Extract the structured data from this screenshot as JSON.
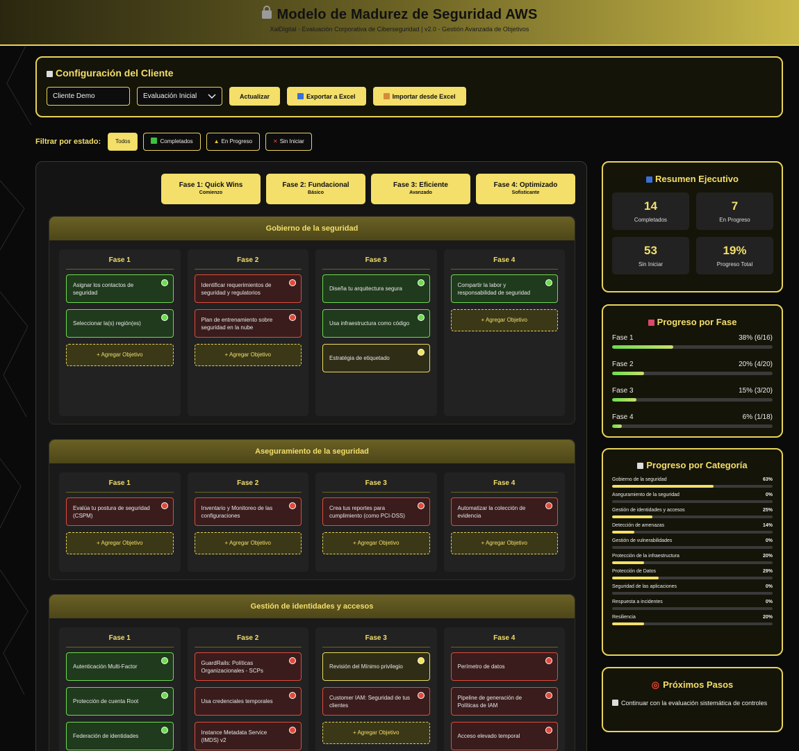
{
  "header": {
    "title": "Modelo de Madurez de Seguridad AWS",
    "subtitle": "XalDigital - Evaluación Corporativa de Ciberseguridad | v2.0 - Gestión Avanzada de Objetivos"
  },
  "config": {
    "title": "Configuración del Cliente",
    "client_value": "Cliente Demo",
    "eval_select": "Evaluación Inicial",
    "update_label": "Actualizar",
    "export_label": "Exportar a Excel",
    "import_label": "Importar desde Excel"
  },
  "filter": {
    "label": "Filtrar por estado:",
    "all": "Todos",
    "completed": "Completados",
    "in_progress": "En Progreso",
    "not_started": "Sin Iniciar"
  },
  "phases": [
    {
      "title": "Fase 1: Quick Wins",
      "sub": "Comienzo"
    },
    {
      "title": "Fase 2: Fundacional",
      "sub": "Básico"
    },
    {
      "title": "Fase 3: Eficiente",
      "sub": "Avanzado"
    },
    {
      "title": "Fase 4: Optimizado",
      "sub": "Sofisticante"
    }
  ],
  "col_labels": [
    "Fase 1",
    "Fase 2",
    "Fase 3",
    "Fase 4"
  ],
  "add_label": "+ Agregar Objetivo",
  "domains": [
    {
      "name": "Gobierno de la seguridad",
      "cols": [
        [
          {
            "text": "Asignar los contactos de seguridad",
            "status": "g"
          },
          {
            "text": "Seleccionar la(s) región(es)",
            "status": "g"
          }
        ],
        [
          {
            "text": "Identificar requerimientos de seguridad y regulatorios",
            "status": "r"
          },
          {
            "text": "Plan de entrenamiento sobre seguridad en la nube",
            "status": "r"
          }
        ],
        [
          {
            "text": "Diseña tu arquitectura segura",
            "status": "g"
          },
          {
            "text": "Usa infraestructura como código",
            "status": "g"
          },
          {
            "text": "Estratégia de etiquetado",
            "status": "y"
          }
        ],
        [
          {
            "text": "Compartir la labor y responsabilidad de seguridad",
            "status": "g"
          }
        ]
      ]
    },
    {
      "name": "Aseguramiento de la seguridad",
      "cols": [
        [
          {
            "text": "Evalúa tu postura de seguridad (CSPM)",
            "status": "r"
          }
        ],
        [
          {
            "text": "Inventario y Monitoreo de las configuraciones",
            "status": "r"
          }
        ],
        [
          {
            "text": "Crea tus reportes para cumplimiento (como PCI-DSS)",
            "status": "r"
          }
        ],
        [
          {
            "text": "Automatizar la colección de evidencia",
            "status": "r"
          }
        ]
      ]
    },
    {
      "name": "Gestión de identidades y accesos",
      "cols": [
        [
          {
            "text": "Autenticación Multi-Factor",
            "status": "g"
          },
          {
            "text": "Protección de cuenta Root",
            "status": "g"
          },
          {
            "text": "Federación de identidades",
            "status": "g"
          }
        ],
        [
          {
            "text": "GuardRails: Políticas Organizacionales - SCPs",
            "status": "r"
          },
          {
            "text": "Usa credenciales temporales",
            "status": "r"
          },
          {
            "text": "Instance Metadata Service (IMDS) v2",
            "status": "r"
          }
        ],
        [
          {
            "text": "Revisión del Mínimo privilegio",
            "status": "y"
          },
          {
            "text": "Customer IAM: Seguridad de tus clientes",
            "status": "r"
          }
        ],
        [
          {
            "text": "Perímetro de datos",
            "status": "r"
          },
          {
            "text": "Pipeline de generación de Políticas de IAM",
            "status": "r"
          },
          {
            "text": "Acceso elevado temporal",
            "status": "r"
          }
        ]
      ]
    }
  ],
  "summary": {
    "title": "Resumen Ejecutivo",
    "stats": [
      {
        "value": "14",
        "label": "Completados"
      },
      {
        "value": "7",
        "label": "En Progreso"
      },
      {
        "value": "53",
        "label": "Sin Iniciar"
      },
      {
        "value": "19%",
        "label": "Progreso Total"
      }
    ]
  },
  "phase_progress": {
    "title": "Progreso por Fase",
    "rows": [
      {
        "label": "Fase 1",
        "value": "38% (6/16)",
        "pct": 38
      },
      {
        "label": "Fase 2",
        "value": "20% (4/20)",
        "pct": 20
      },
      {
        "label": "Fase 3",
        "value": "15% (3/20)",
        "pct": 15
      },
      {
        "label": "Fase 4",
        "value": "6% (1/18)",
        "pct": 6
      }
    ]
  },
  "category_progress": {
    "title": "Progreso por Categoría",
    "rows": [
      {
        "label": "Gobierno de la seguridad",
        "value": "63%",
        "pct": 63
      },
      {
        "label": "Aseguramiento de la seguridad",
        "value": "0%",
        "pct": 0
      },
      {
        "label": "Gestión de identidades y accesos",
        "value": "25%",
        "pct": 25
      },
      {
        "label": "Detección de amenazas",
        "value": "14%",
        "pct": 14
      },
      {
        "label": "Gestión de vulnerabilidades",
        "value": "0%",
        "pct": 0
      },
      {
        "label": "Protección de la infraestructura",
        "value": "20%",
        "pct": 20
      },
      {
        "label": "Protección de Datos",
        "value": "29%",
        "pct": 29
      },
      {
        "label": "Seguridad de las aplicaciones",
        "value": "0%",
        "pct": 0
      },
      {
        "label": "Respuesta a incidentes",
        "value": "0%",
        "pct": 0
      },
      {
        "label": "Resiliencia",
        "value": "20%",
        "pct": 20
      }
    ]
  },
  "next_steps": {
    "title": "Próximos Pasos",
    "text": "Continuar con la evaluación sistemática de controles"
  },
  "colors": {
    "accent": "#f3df6a",
    "green": "#6ddc4e",
    "red": "#e04b3b",
    "yellow": "#f3e45a"
  }
}
